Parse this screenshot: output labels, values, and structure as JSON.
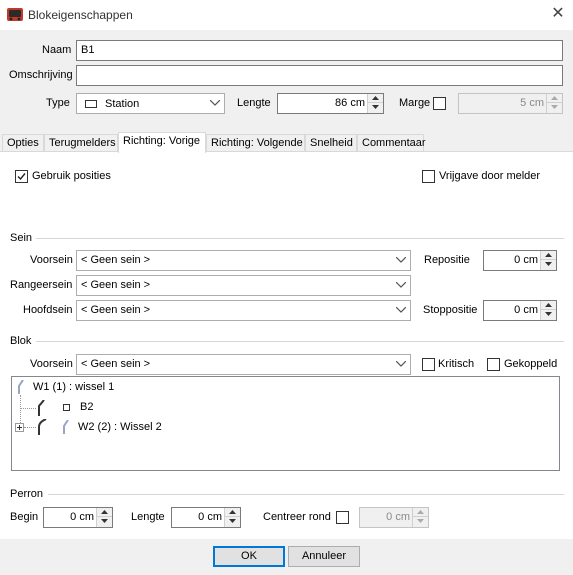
{
  "window": {
    "title": "Blokeigenschappen"
  },
  "header": {
    "naam_label": "Naam",
    "naam_value": "B1",
    "omschrijving_label": "Omschrijving",
    "omschrijving_value": "",
    "type_label": "Type",
    "type_value": "Station",
    "lengte_label": "Lengte",
    "lengte_value": "86 cm",
    "marge_label": "Marge",
    "marge_checked": false,
    "marge_value": "5 cm"
  },
  "tabs": [
    {
      "label": "Opties",
      "active": false
    },
    {
      "label": "Terugmelders",
      "active": false
    },
    {
      "label": "Richting: Vorige",
      "active": true
    },
    {
      "label": "Richting: Volgende",
      "active": false
    },
    {
      "label": "Snelheid",
      "active": false
    },
    {
      "label": "Commentaar",
      "active": false
    }
  ],
  "options": {
    "gebruik_posities_label": "Gebruik posities",
    "gebruik_posities_checked": true,
    "vrijgave_label": "Vrijgave door melder",
    "vrijgave_checked": false
  },
  "sein": {
    "group_label": "Sein",
    "voorsein_label": "Voorsein",
    "voorsein_value": "< Geen sein >",
    "rangeersein_label": "Rangeersein",
    "rangeersein_value": "< Geen sein >",
    "hoofdsein_label": "Hoofdsein",
    "hoofdsein_value": "< Geen sein >",
    "repositie_label": "Repositie",
    "repositie_value": "0 cm",
    "stoppositie_label": "Stoppositie",
    "stoppositie_value": "0 cm"
  },
  "blok": {
    "group_label": "Blok",
    "voorsein_label": "Voorsein",
    "voorsein_value": "< Geen sein >",
    "kritisch_label": "Kritisch",
    "kritisch_checked": false,
    "gekoppeld_label": "Gekoppeld",
    "gekoppeld_checked": false,
    "tree": [
      {
        "label": "W1 (1) : wissel 1"
      },
      {
        "label": "B2"
      },
      {
        "label": "W2 (2) : Wissel 2"
      }
    ]
  },
  "perron": {
    "group_label": "Perron",
    "begin_label": "Begin",
    "begin_value": "0 cm",
    "lengte_label": "Lengte",
    "lengte_value": "0 cm",
    "centreer_label": "Centreer rond",
    "centreer_checked": false,
    "centreer_value": "0 cm"
  },
  "footer": {
    "ok_label": "OK",
    "annuleer_label": "Annuleer"
  },
  "colors": {
    "accent": "#0078d7",
    "window_bg": "#f0f0f0",
    "switch_icon": "#9aa3c8",
    "rail_dark": "#333333"
  }
}
